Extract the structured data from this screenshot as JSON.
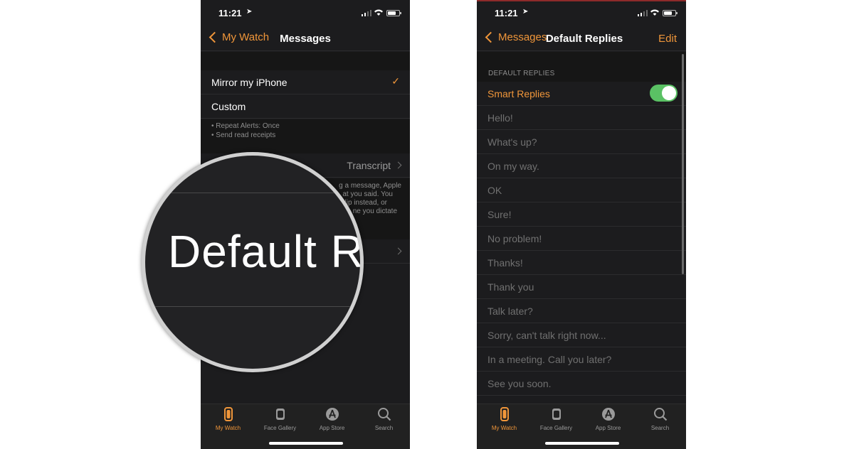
{
  "left_screen": {
    "status": {
      "time": "11:21"
    },
    "nav": {
      "back_label": "My Watch",
      "title": "Messages"
    },
    "options": [
      {
        "label": "Mirror my iPhone",
        "selected": true
      },
      {
        "label": "Custom",
        "selected": false
      }
    ],
    "custom_notes": [
      "• Repeat Alerts: Once",
      "• Send read receipts"
    ],
    "audio_row_value": "Transcript",
    "audio_desc_lines": [
      "g a message, Apple",
      "at you said. You",
      "clip instead, or",
      "ne you dictate"
    ],
    "magnifier_text": "Default Re"
  },
  "right_screen": {
    "status": {
      "time": "11:21"
    },
    "nav": {
      "back_label": "Messages",
      "title": "Default Replies",
      "edit_label": "Edit"
    },
    "section_header": "DEFAULT REPLIES",
    "smart_replies": {
      "label": "Smart Replies",
      "enabled": true
    },
    "replies": [
      "Hello!",
      "What's up?",
      "On my way.",
      "OK",
      "Sure!",
      "No problem!",
      "Thanks!",
      "Thank you",
      "Talk later?",
      "Sorry, can't talk right now...",
      "In a meeting. Call you later?",
      "See you soon."
    ]
  },
  "tabbar": {
    "tabs": [
      {
        "label": "My Watch",
        "icon": "watch-icon",
        "active": true
      },
      {
        "label": "Face Gallery",
        "icon": "face-gallery-icon",
        "active": false
      },
      {
        "label": "App Store",
        "icon": "app-store-icon",
        "active": false
      },
      {
        "label": "Search",
        "icon": "search-icon",
        "active": false
      }
    ]
  },
  "colors": {
    "accent": "#f0963a",
    "background": "#1c1c1e",
    "toggle_on": "#5ac164"
  }
}
